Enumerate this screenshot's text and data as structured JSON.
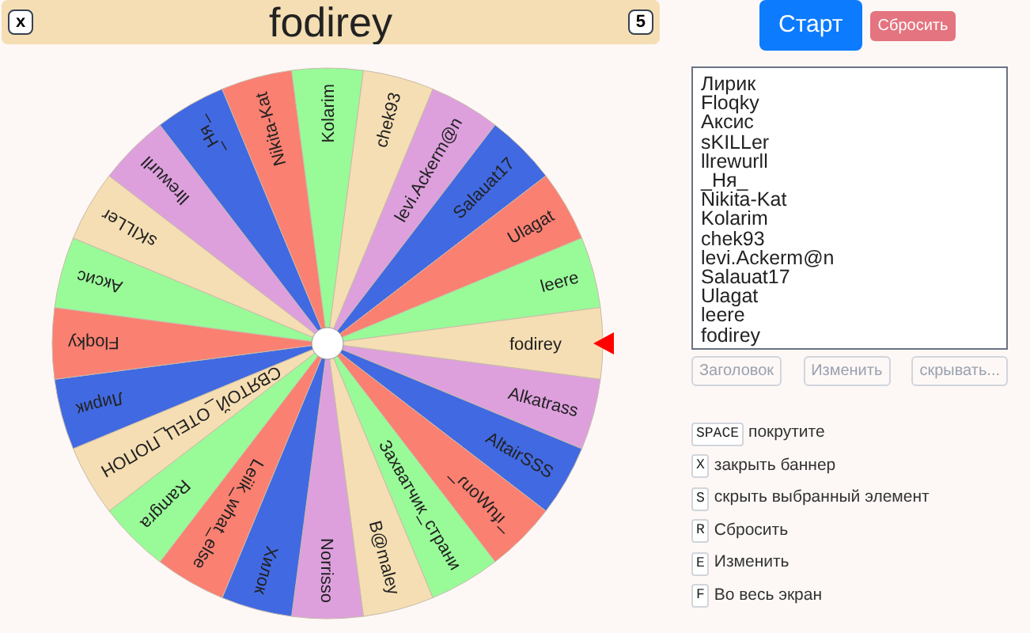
{
  "banner": {
    "close_key": "x",
    "hide_key": "5",
    "title": "fodirey"
  },
  "wheel": {
    "segments": [
      {
        "label": "Лирик",
        "color": "#4169e1"
      },
      {
        "label": "Floqky",
        "color": "#fa8072"
      },
      {
        "label": "Аксис",
        "color": "#98fb98"
      },
      {
        "label": "sKILLer",
        "color": "#f5deb3"
      },
      {
        "label": "llrewurll",
        "color": "#dda0dd"
      },
      {
        "label": "_Ня_",
        "color": "#4169e1"
      },
      {
        "label": "Nikita-Kat",
        "color": "#fa8072"
      },
      {
        "label": "Kolarim",
        "color": "#98fb98"
      },
      {
        "label": "chek93",
        "color": "#f5deb3"
      },
      {
        "label": "levi.Ackerm@n",
        "color": "#dda0dd"
      },
      {
        "label": "Salauat17",
        "color": "#4169e1"
      },
      {
        "label": "Ulagat",
        "color": "#fa8072"
      },
      {
        "label": "leere",
        "color": "#98fb98"
      },
      {
        "label": "fodirey",
        "color": "#f5deb3",
        "selected": true
      },
      {
        "label": "Alkatrass",
        "color": "#dda0dd"
      },
      {
        "label": "AltairSSS",
        "color": "#4169e1"
      },
      {
        "label": "_ɾuoWnɟı_",
        "color": "#fa8072"
      },
      {
        "label": "Захватчик_страни",
        "color": "#98fb98"
      },
      {
        "label": "B@maley",
        "color": "#f5deb3"
      },
      {
        "label": "Norrisso",
        "color": "#dda0dd"
      },
      {
        "label": "Хилок",
        "color": "#4169e1"
      },
      {
        "label": "Leiik_what_else",
        "color": "#fa8072"
      },
      {
        "label": "Ramgra",
        "color": "#98fb98"
      },
      {
        "label": "СВЯТОЙ_ОТЕЦ_ПОПОН",
        "color": "#f5deb3"
      }
    ]
  },
  "start_button": "Старт",
  "reset_button": "Сбросить",
  "names_field": {
    "lines": [
      "Лирик",
      "Floqky",
      "Аксис",
      "sKILLer",
      "llrewurll",
      "_Ня_",
      "Nikita-Kat",
      "Kolarim",
      "chek93",
      "levi.Ackerm@n",
      "Salauat17",
      "Ulagat",
      "leere",
      "fodirey"
    ]
  },
  "field_buttons": [
    "Заголовок",
    "Изменить",
    "скрывать..."
  ],
  "shortcuts": [
    {
      "key": "SPACE",
      "action": "покрутите"
    },
    {
      "key": "X",
      "action": "закрыть баннер"
    },
    {
      "key": "S",
      "action": "скрыть выбранный элемент"
    },
    {
      "key": "R",
      "action": "Сбросить"
    },
    {
      "key": "E",
      "action": "Изменить"
    },
    {
      "key": "F",
      "action": "Во весь экран"
    }
  ]
}
